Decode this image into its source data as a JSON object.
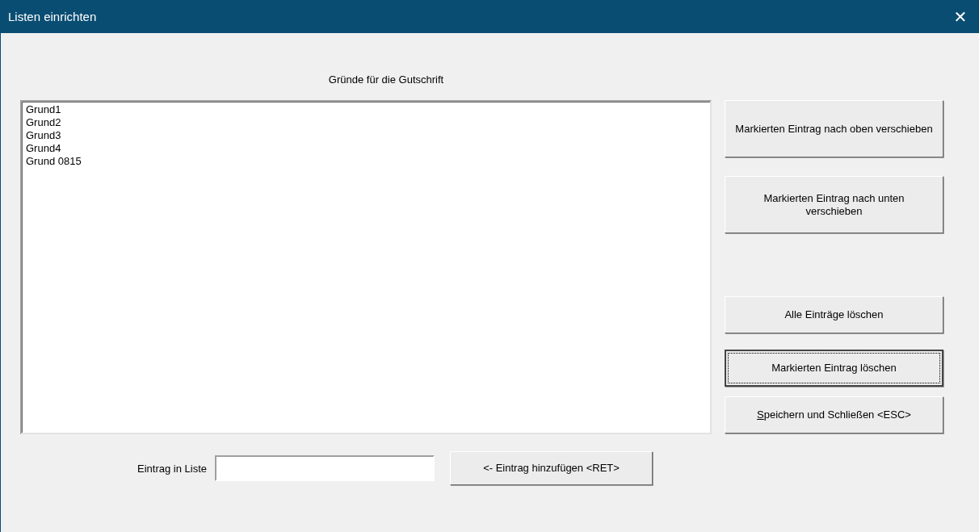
{
  "window": {
    "title": "Listen einrichten",
    "close": "✕"
  },
  "list": {
    "heading": "Gründe für die Gutschrift",
    "items": [
      "Grund1",
      "Grund2",
      "Grund3",
      "Grund4",
      "Grund 0815"
    ]
  },
  "entry": {
    "label": "Eintrag in Liste",
    "add_button": "<- Eintrag hinzufügen <RET>"
  },
  "buttons": [
    {
      "label": "Markierten Eintrag nach oben verschieben",
      "kind": "tall",
      "focused": false,
      "mnemonic": false
    },
    {
      "label": "Markierten Eintrag nach unten verschieben",
      "kind": "tall",
      "focused": false,
      "mnemonic": false
    },
    {
      "label": "Alle Einträge löschen",
      "kind": "short",
      "focused": false,
      "mnemonic": false
    },
    {
      "label": "Markierten Eintrag löschen",
      "kind": "short",
      "focused": true,
      "mnemonic": false
    },
    {
      "label": "Speichern und Schließen <ESC>",
      "kind": "short",
      "focused": false,
      "mnemonic": true
    }
  ]
}
